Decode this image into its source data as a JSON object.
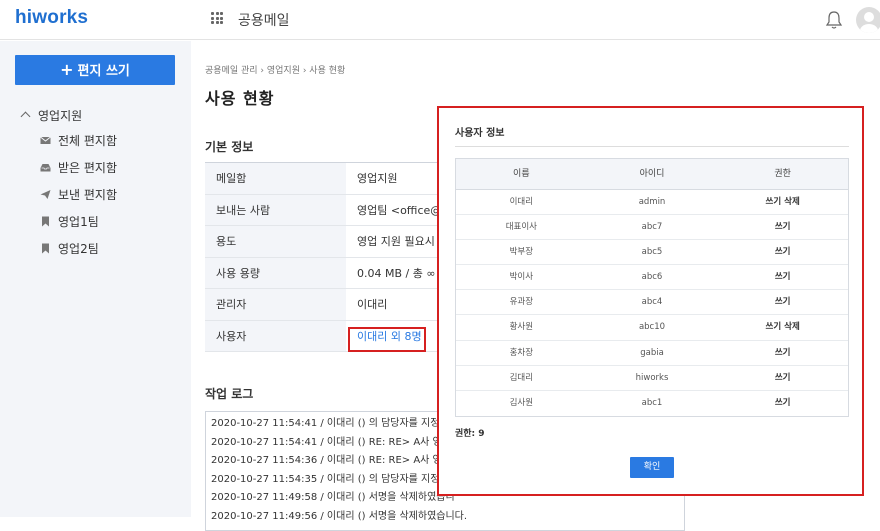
{
  "header": {
    "logo": "hiworks",
    "app_title": "공용메일"
  },
  "sidebar": {
    "write_label": "편지 쓰기",
    "group_label": "영업지원",
    "items": [
      {
        "label": "전체 편지함",
        "icon": "mail-icon"
      },
      {
        "label": "받은 편지함",
        "icon": "inbox-icon"
      },
      {
        "label": "보낸 편지함",
        "icon": "send-icon"
      },
      {
        "label": "영업1팀",
        "icon": "bookmark-icon"
      },
      {
        "label": "영업2팀",
        "icon": "bookmark-icon"
      }
    ]
  },
  "main": {
    "breadcrumb": "공용메일 관리 › 영업지원 › 사용 현황",
    "title": "사용 현황",
    "basic_info_title": "기본 정보",
    "info_rows": [
      {
        "label": "메일함",
        "value": "영업지원"
      },
      {
        "label": "보내는 사람",
        "value": "영업팀 <office@g"
      },
      {
        "label": "용도",
        "value": "영업 지원 필요시"
      },
      {
        "label": "사용 용량",
        "value": "0.04 MB / 총 ∞ M"
      },
      {
        "label": "관리자",
        "value": "이대리"
      },
      {
        "label": "사용자",
        "value": "이대리 외 8명"
      }
    ],
    "log_title": "작업 로그",
    "logs": [
      "2020-10-27 11:54:41 / 이대리 () 의 담당자를 지정하",
      "2020-10-27 11:54:41 / 이대리 () RE: RE> A사 영업",
      "2020-10-27 11:54:36 / 이대리 () RE: RE> A사 영업",
      "2020-10-27 11:54:35 / 이대리 () 의 담당자를 지정하",
      "2020-10-27 11:49:58 / 이대리 () 서명을 삭제하였습니",
      "2020-10-27 11:49:56 / 이대리 () 서명을 삭제하였습니다."
    ]
  },
  "modal": {
    "title": "사용자 정보",
    "columns": [
      "이름",
      "아이디",
      "권한"
    ],
    "rows": [
      [
        "이대리",
        "admin",
        "쓰기  삭제"
      ],
      [
        "대표이사",
        "abc7",
        "쓰기"
      ],
      [
        "박부장",
        "abc5",
        "쓰기"
      ],
      [
        "박이사",
        "abc6",
        "쓰기"
      ],
      [
        "유과장",
        "abc4",
        "쓰기"
      ],
      [
        "황사원",
        "abc10",
        "쓰기  삭제"
      ],
      [
        "홍차장",
        "gabia",
        "쓰기"
      ],
      [
        "김대리",
        "hiworks",
        "쓰기"
      ],
      [
        "김사원",
        "abc1",
        "쓰기"
      ]
    ],
    "count_label": "권한: 9",
    "confirm_label": "확인"
  },
  "colors": {
    "brand": "#1f6fd0",
    "accent": "#2a7ae2",
    "highlight": "#d62020"
  }
}
